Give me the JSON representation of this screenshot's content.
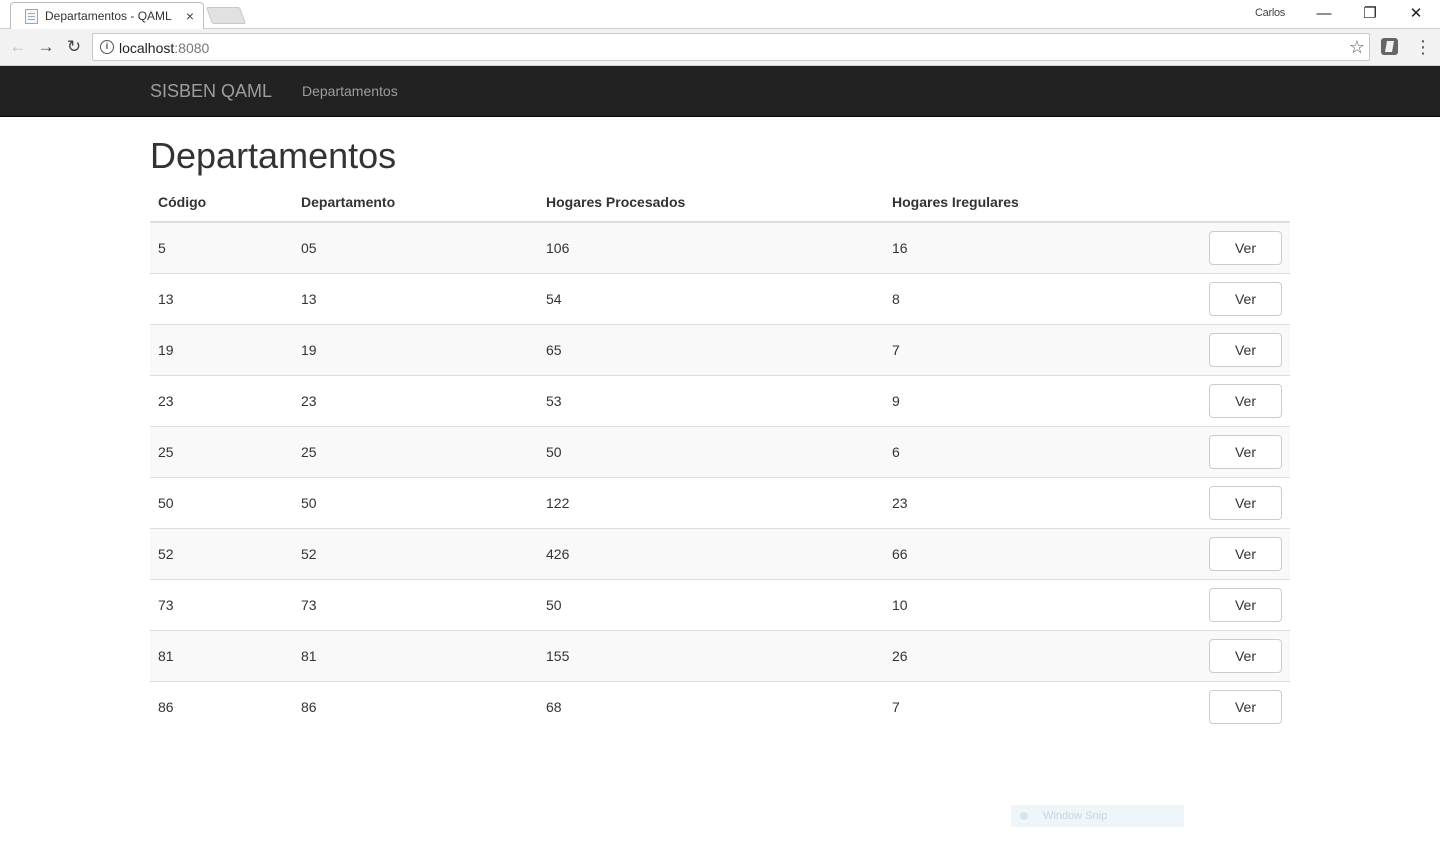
{
  "browser": {
    "tab_title": "Departamentos - QAML S",
    "tab_close": "×",
    "user": "Carlos",
    "window_controls": {
      "minimize": "—",
      "restore": "❐",
      "close": "✕"
    },
    "url_host": "localhost",
    "url_port": ":8080",
    "icons": [
      "back-icon",
      "forward-icon",
      "reload-icon",
      "info-icon",
      "star-icon",
      "extension-icon",
      "menu-icon"
    ]
  },
  "navbar": {
    "brand": "SISBEN QAML",
    "link": "Departamentos"
  },
  "page": {
    "title": "Departamentos"
  },
  "table": {
    "headers": [
      "Código",
      "Departamento",
      "Hogares Procesados",
      "Hogares Iregulares"
    ],
    "button_label": "Ver",
    "rows": [
      [
        "5",
        "05",
        "106",
        "16"
      ],
      [
        "13",
        "13",
        "54",
        "8"
      ],
      [
        "19",
        "19",
        "65",
        "7"
      ],
      [
        "23",
        "23",
        "53",
        "9"
      ],
      [
        "25",
        "25",
        "50",
        "6"
      ],
      [
        "50",
        "50",
        "122",
        "23"
      ],
      [
        "52",
        "52",
        "426",
        "66"
      ],
      [
        "73",
        "73",
        "50",
        "10"
      ],
      [
        "81",
        "81",
        "155",
        "26"
      ],
      [
        "86",
        "86",
        "68",
        "7"
      ]
    ]
  },
  "overlay": {
    "snip_label": "Window Snip"
  },
  "colors": {
    "navbar_bg": "#222222",
    "navbar_text": "#9d9d9d",
    "row_stripe": "#f9f9f9",
    "border": "#dddddd"
  }
}
